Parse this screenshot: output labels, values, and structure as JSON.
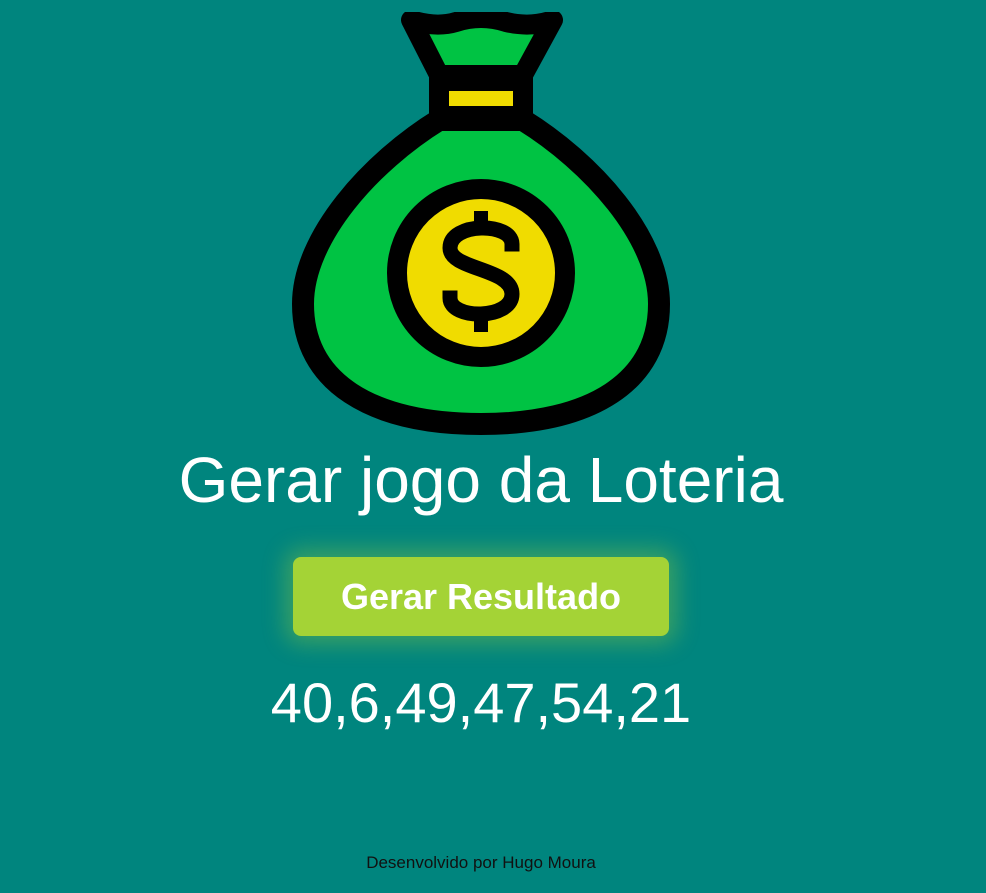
{
  "header": {
    "logo_icon": "money-bag-icon",
    "title": "Gerar jogo da Loteria"
  },
  "actions": {
    "generate_label": "Gerar Resultado"
  },
  "result": {
    "numbers": "40,6,49,47,54,21"
  },
  "footer": {
    "credit": "Desenvolvido por Hugo Moura"
  },
  "colors": {
    "background": "#00857e",
    "button": "#a4d336",
    "bag": "#00c343",
    "coin": "#f0dc00",
    "outline": "#000000"
  }
}
